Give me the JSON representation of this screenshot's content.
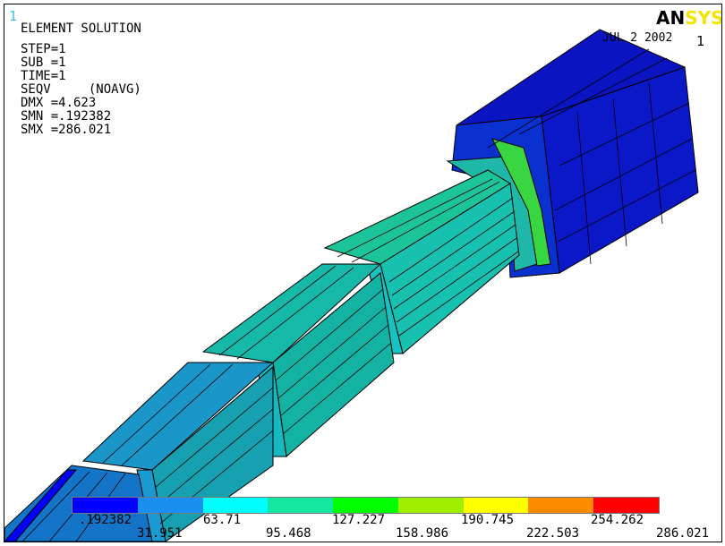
{
  "window": {
    "number": "1"
  },
  "logo": {
    "part1": "AN",
    "part2": "SYS"
  },
  "header": {
    "date": "JUL 2 2002",
    "page_number": "1"
  },
  "solution": {
    "title": "ELEMENT SOLUTION",
    "lines": [
      "STEP=1",
      "SUB =1",
      "TIME=1",
      "SEQV     (NOAVG)",
      "DMX =4.623",
      "SMN =.192382",
      "SMX =286.021"
    ]
  },
  "legend": {
    "colors": [
      "#0000ff",
      "#1a8ff0",
      "#00ffff",
      "#15e6a0",
      "#00ff00",
      "#a0ee00",
      "#ffff00",
      "#ff8c00",
      "#ff0000"
    ],
    "top_labels": [
      ".192382",
      "63.71",
      "127.227",
      "190.745",
      "254.262"
    ],
    "bottom_labels": [
      "31.951",
      "95.468",
      "158.986",
      "222.503",
      "286.021"
    ]
  }
}
